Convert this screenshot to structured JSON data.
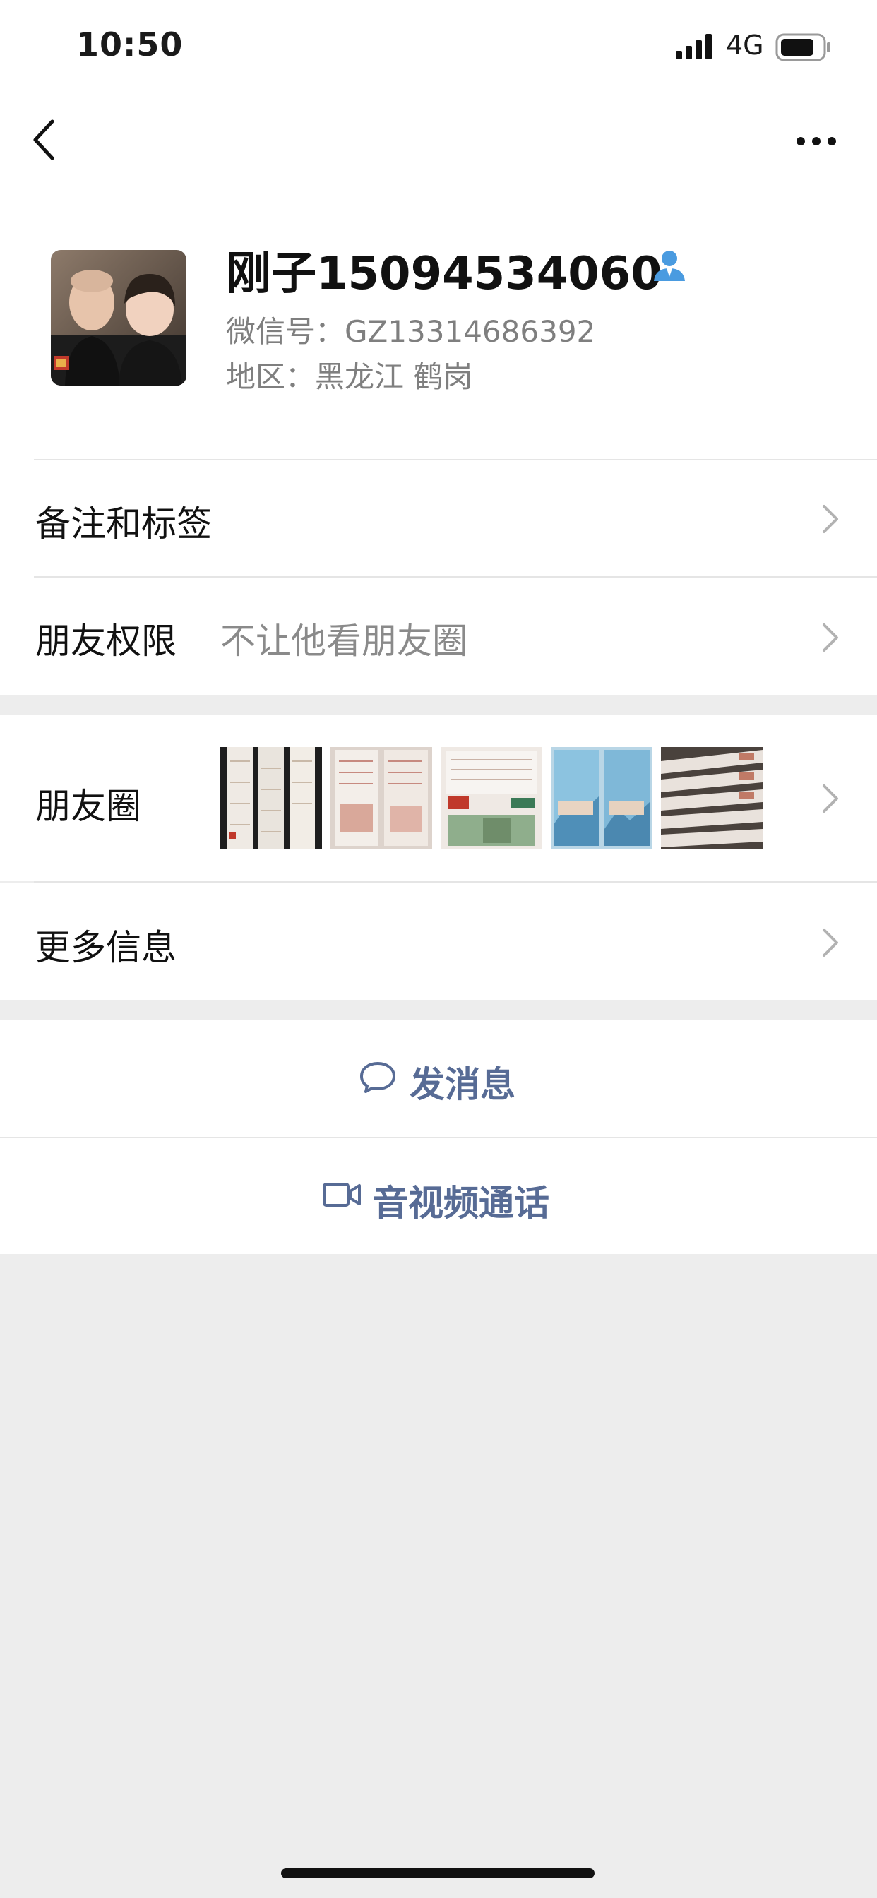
{
  "status_bar": {
    "time": "10:50",
    "network": "4G"
  },
  "profile": {
    "name": "刚子15094534060",
    "wechat_id": "微信号：GZ13314686392",
    "region": "地区：黑龙江 鹤岗"
  },
  "rows": {
    "remarks_label": "备注和标签",
    "permissions_label": "朋友权限",
    "permissions_value": "不让他看朋友圈",
    "moments_label": "朋友圈",
    "more_info_label": "更多信息"
  },
  "actions": {
    "message_label": "发消息",
    "call_label": "音视频通话"
  },
  "icons": {
    "back": "chevron-left-icon",
    "more": "more-dots-icon",
    "badge": "contact-badge-icon",
    "chevron": "chevron-right-icon",
    "message": "chat-bubble-icon",
    "call": "video-camera-icon"
  },
  "colors": {
    "link": "#576b95",
    "badge": "#4a9be0",
    "background": "#ededed"
  }
}
